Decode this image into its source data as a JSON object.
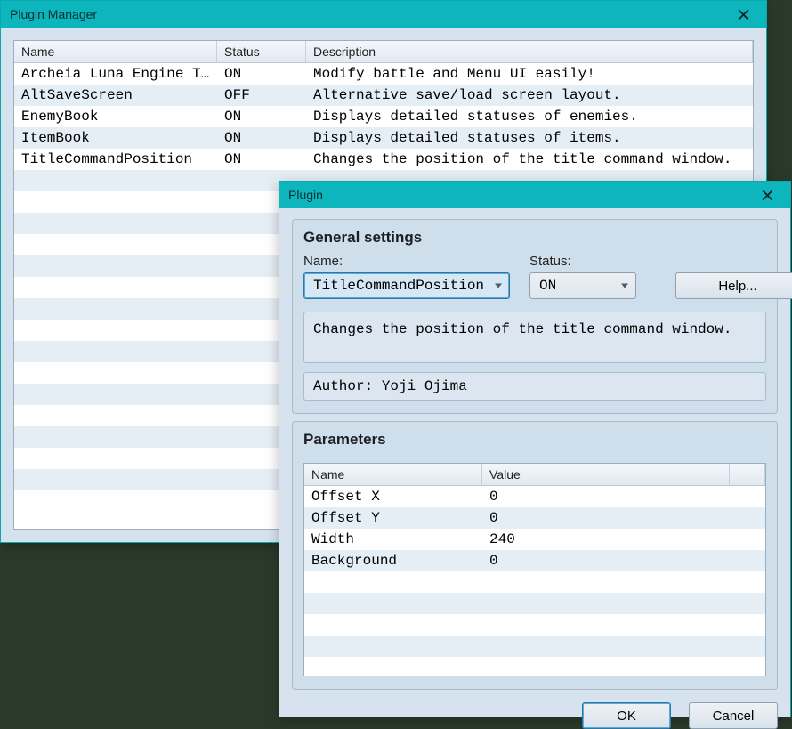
{
  "manager": {
    "title": "Plugin Manager",
    "columns": {
      "name": "Name",
      "status": "Status",
      "description": "Description"
    },
    "rows": [
      {
        "name": "Archeia Luna Engine Test",
        "status": "ON",
        "desc": "Modify battle and Menu UI easily!"
      },
      {
        "name": "AltSaveScreen",
        "status": "OFF",
        "desc": "Alternative save/load screen layout."
      },
      {
        "name": "EnemyBook",
        "status": "ON",
        "desc": "Displays detailed statuses of enemies."
      },
      {
        "name": "ItemBook",
        "status": "ON",
        "desc": "Displays detailed statuses of items."
      },
      {
        "name": "TitleCommandPosition",
        "status": "ON",
        "desc": "Changes the position of the title command window."
      }
    ],
    "blank_rows": 15
  },
  "plugin": {
    "title": "Plugin",
    "general": {
      "heading": "General settings",
      "name_label": "Name:",
      "status_label": "Status:",
      "name_value": "TitleCommandPosition",
      "status_value": "ON",
      "help_label": "Help...",
      "description": "Changes the position of the title command window.",
      "author_prefix": "Author: ",
      "author": "Yoji Ojima"
    },
    "params": {
      "heading": "Parameters",
      "columns": {
        "name": "Name",
        "value": "Value"
      },
      "rows": [
        {
          "name": "Offset X",
          "value": "0"
        },
        {
          "name": "Offset Y",
          "value": "0"
        },
        {
          "name": "Width",
          "value": "240"
        },
        {
          "name": "Background",
          "value": "0"
        }
      ],
      "blank_rows": 5
    },
    "buttons": {
      "ok": "OK",
      "cancel": "Cancel"
    }
  }
}
